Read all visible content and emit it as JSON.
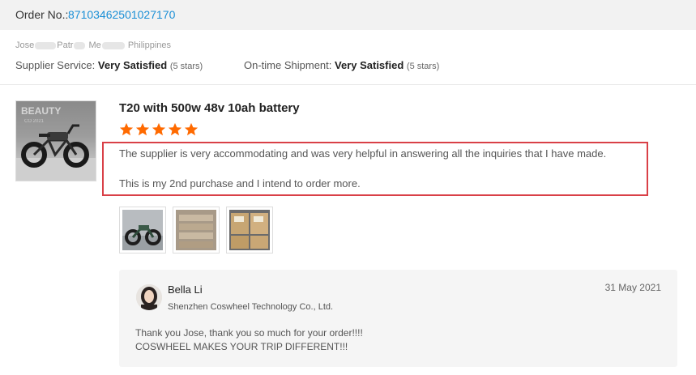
{
  "order": {
    "label": "Order No.:",
    "number": "87103462501027170",
    "link_color": "#1a8fd6"
  },
  "buyer": {
    "name_parts": [
      "Jose",
      "Patr",
      "Me",
      "Philippines"
    ]
  },
  "ratings": {
    "supplier_label": "Supplier Service:",
    "supplier_value": "Very Satisfied",
    "supplier_stars": "(5 stars)",
    "shipment_label": "On-time Shipment:",
    "shipment_value": "Very Satisfied",
    "shipment_stars": "(5 stars)"
  },
  "product": {
    "title": "T20 with 500w 48v 10ah battery",
    "rating": 5,
    "star_color": "#ff6a00",
    "thumbnail_icon": "ebike-photo"
  },
  "review": {
    "line1": "The supplier is very accommodating and was very helpful in answering all the inquiries that I have made.",
    "line2": "This is my 2nd purchase and I intend to order more.",
    "highlight_color": "#d94047"
  },
  "photos": [
    {
      "icon": "ebike-photo"
    },
    {
      "icon": "boxes-photo"
    },
    {
      "icon": "cartons-photo"
    }
  ],
  "reply": {
    "name": "Bella Li",
    "company": "Shenzhen Coswheel Technology Co., Ltd.",
    "date": "31 May 2021",
    "message_line1": "Thank you Jose, thank you so much for your order!!!!",
    "message_line2": "COSWHEEL MAKES YOUR TRIP DIFFERENT!!!"
  }
}
